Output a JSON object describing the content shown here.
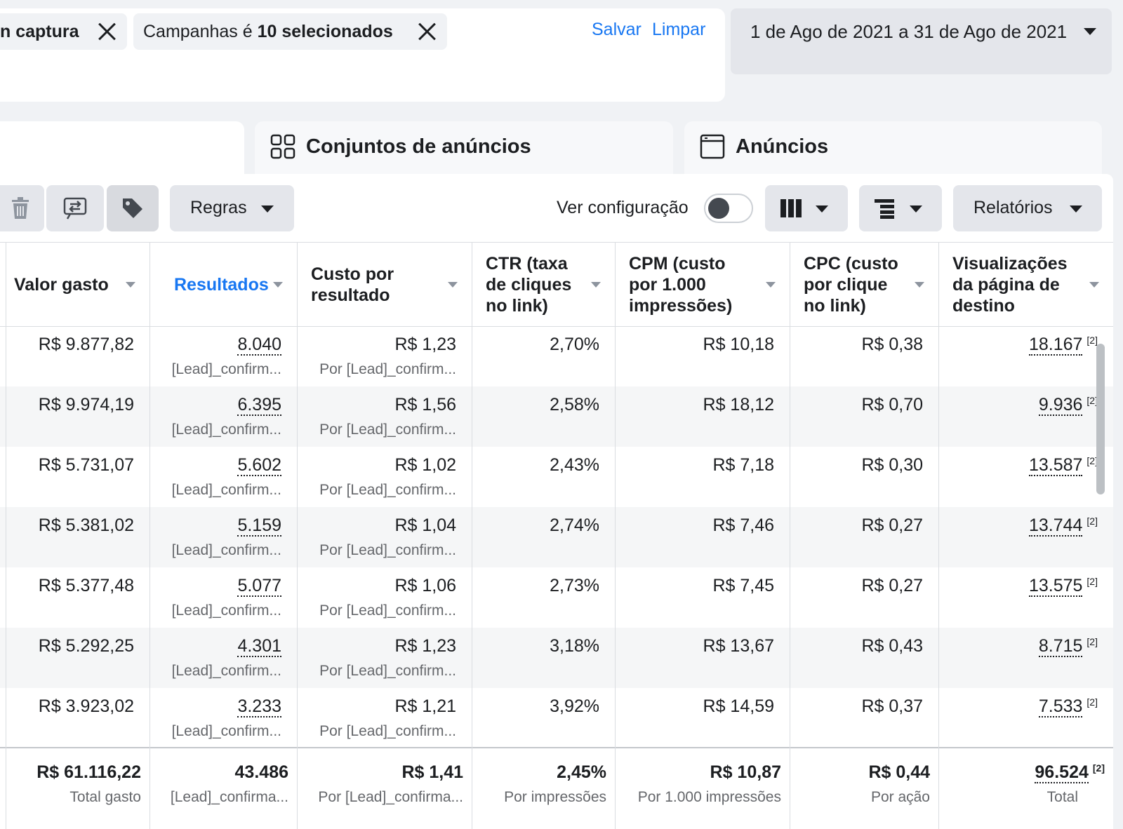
{
  "filters": {
    "chip1": "n captura",
    "chip2_prefix": "Campanhas é ",
    "chip2_bold": "10 selecionados",
    "save_label": "Salvar",
    "clear_label": "Limpar"
  },
  "date_range": "1 de Ago de 2021 a 31 de Ago de 2021",
  "tabs": {
    "adsets": "Conjuntos de anúncios",
    "ads": "Anúncios"
  },
  "toolbar": {
    "rules": "Regras",
    "view_config": "Ver configuração",
    "reports": "Relatórios"
  },
  "columns": [
    "Valor gasto",
    "Resultados",
    "Custo por resultado",
    "CTR (taxa de cliques no link)",
    "CPM (custo por 1.000 impressões)",
    "CPC (custo por clique no link)",
    "Visualizações da página de destino"
  ],
  "rows": [
    {
      "spend": "R$ 9.877,82",
      "results": "8.040",
      "results_sub": "[Lead]_confirm...",
      "cpr": "R$ 1,23",
      "cpr_sub": "Por [Lead]_confirm...",
      "ctr": "2,70%",
      "cpm": "R$ 10,18",
      "cpc": "R$ 0,38",
      "views": "18.167",
      "views_note": "[2]"
    },
    {
      "spend": "R$ 9.974,19",
      "results": "6.395",
      "results_sub": "[Lead]_confirm...",
      "cpr": "R$ 1,56",
      "cpr_sub": "Por [Lead]_confirm...",
      "ctr": "2,58%",
      "cpm": "R$ 18,12",
      "cpc": "R$ 0,70",
      "views": "9.936",
      "views_note": "[2]"
    },
    {
      "spend": "R$ 5.731,07",
      "results": "5.602",
      "results_sub": "[Lead]_confirm...",
      "cpr": "R$ 1,02",
      "cpr_sub": "Por [Lead]_confirm...",
      "ctr": "2,43%",
      "cpm": "R$ 7,18",
      "cpc": "R$ 0,30",
      "views": "13.587",
      "views_note": "[2]"
    },
    {
      "spend": "R$ 5.381,02",
      "results": "5.159",
      "results_sub": "[Lead]_confirm...",
      "cpr": "R$ 1,04",
      "cpr_sub": "Por [Lead]_confirm...",
      "ctr": "2,74%",
      "cpm": "R$ 7,46",
      "cpc": "R$ 0,27",
      "views": "13.744",
      "views_note": "[2]"
    },
    {
      "spend": "R$ 5.377,48",
      "results": "5.077",
      "results_sub": "[Lead]_confirm...",
      "cpr": "R$ 1,06",
      "cpr_sub": "Por [Lead]_confirm...",
      "ctr": "2,73%",
      "cpm": "R$ 7,45",
      "cpc": "R$ 0,27",
      "views": "13.575",
      "views_note": "[2]"
    },
    {
      "spend": "R$ 5.292,25",
      "results": "4.301",
      "results_sub": "[Lead]_confirm...",
      "cpr": "R$ 1,23",
      "cpr_sub": "Por [Lead]_confirm...",
      "ctr": "3,18%",
      "cpm": "R$ 13,67",
      "cpc": "R$ 0,43",
      "views": "8.715",
      "views_note": "[2]"
    },
    {
      "spend": "R$ 3.923,02",
      "results": "3.233",
      "results_sub": "[Lead]_confirm...",
      "cpr": "R$ 1,21",
      "cpr_sub": "Por [Lead]_confirm...",
      "ctr": "3,92%",
      "cpm": "R$ 14,59",
      "cpc": "R$ 0,37",
      "views": "7.533",
      "views_note": "[2]"
    }
  ],
  "totals": {
    "spend": "R$ 61.116,22",
    "spend_sub": "Total gasto",
    "results": "43.486",
    "results_sub": "[Lead]_confirma...",
    "cpr": "R$ 1,41",
    "cpr_sub": "Por [Lead]_confirma...",
    "ctr": "2,45%",
    "ctr_sub": "Por impressões",
    "cpm": "R$ 10,87",
    "cpm_sub": "Por 1.000 impressões",
    "cpc": "R$ 0,44",
    "cpc_sub": "Por ação",
    "views": "96.524",
    "views_note": "[2]",
    "views_sub": "Total"
  },
  "colors": {
    "accent": "#1877f2",
    "text": "#1c1e21",
    "muted": "#65676b",
    "row_alt": "#f5f6f7"
  }
}
